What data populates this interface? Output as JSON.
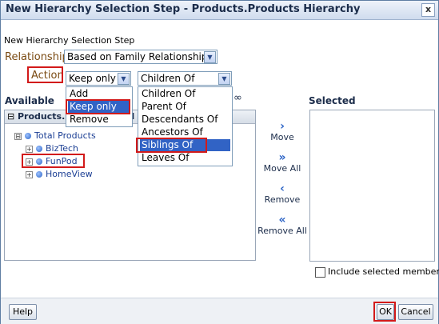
{
  "dialog": {
    "title": "New Hierarchy Selection Step - Products.Products Hierarchy",
    "close_glyph": "x",
    "step_label": "New Hierarchy Selection Step"
  },
  "relationship": {
    "label": "Relationship",
    "value": "Based on Family Relationship"
  },
  "action": {
    "label": "Action",
    "selected": "Keep only",
    "options": [
      "Add",
      "Keep only",
      "Remove"
    ],
    "relation_selected": "Children Of",
    "relation_options": [
      "Children Of",
      "Parent Of",
      "Descendants Of",
      "Ancestors Of",
      "Siblings Of",
      "Leaves Of"
    ]
  },
  "available": {
    "label": "Available",
    "panel_title": "Products.P",
    "panel_title_tail": "cl",
    "tree": [
      {
        "label": "Total Products",
        "level": 0,
        "expander": "⊟"
      },
      {
        "label": "BizTech",
        "level": 1,
        "expander": "+"
      },
      {
        "label": "FunPod",
        "level": 1,
        "expander": "+"
      },
      {
        "label": "HomeView",
        "level": 1,
        "expander": "+"
      }
    ]
  },
  "shuttle": {
    "move": "Move",
    "move_all": "Move All",
    "remove": "Remove",
    "remove_all": "Remove All"
  },
  "selected": {
    "label": "Selected",
    "include_label": "Include selected members"
  },
  "buttons": {
    "help": "Help",
    "ok": "OK",
    "cancel": "Cancel"
  },
  "colors": {
    "highlight": "#3163c5",
    "annotation": "#d21a1a",
    "link": "#1c3f94"
  }
}
